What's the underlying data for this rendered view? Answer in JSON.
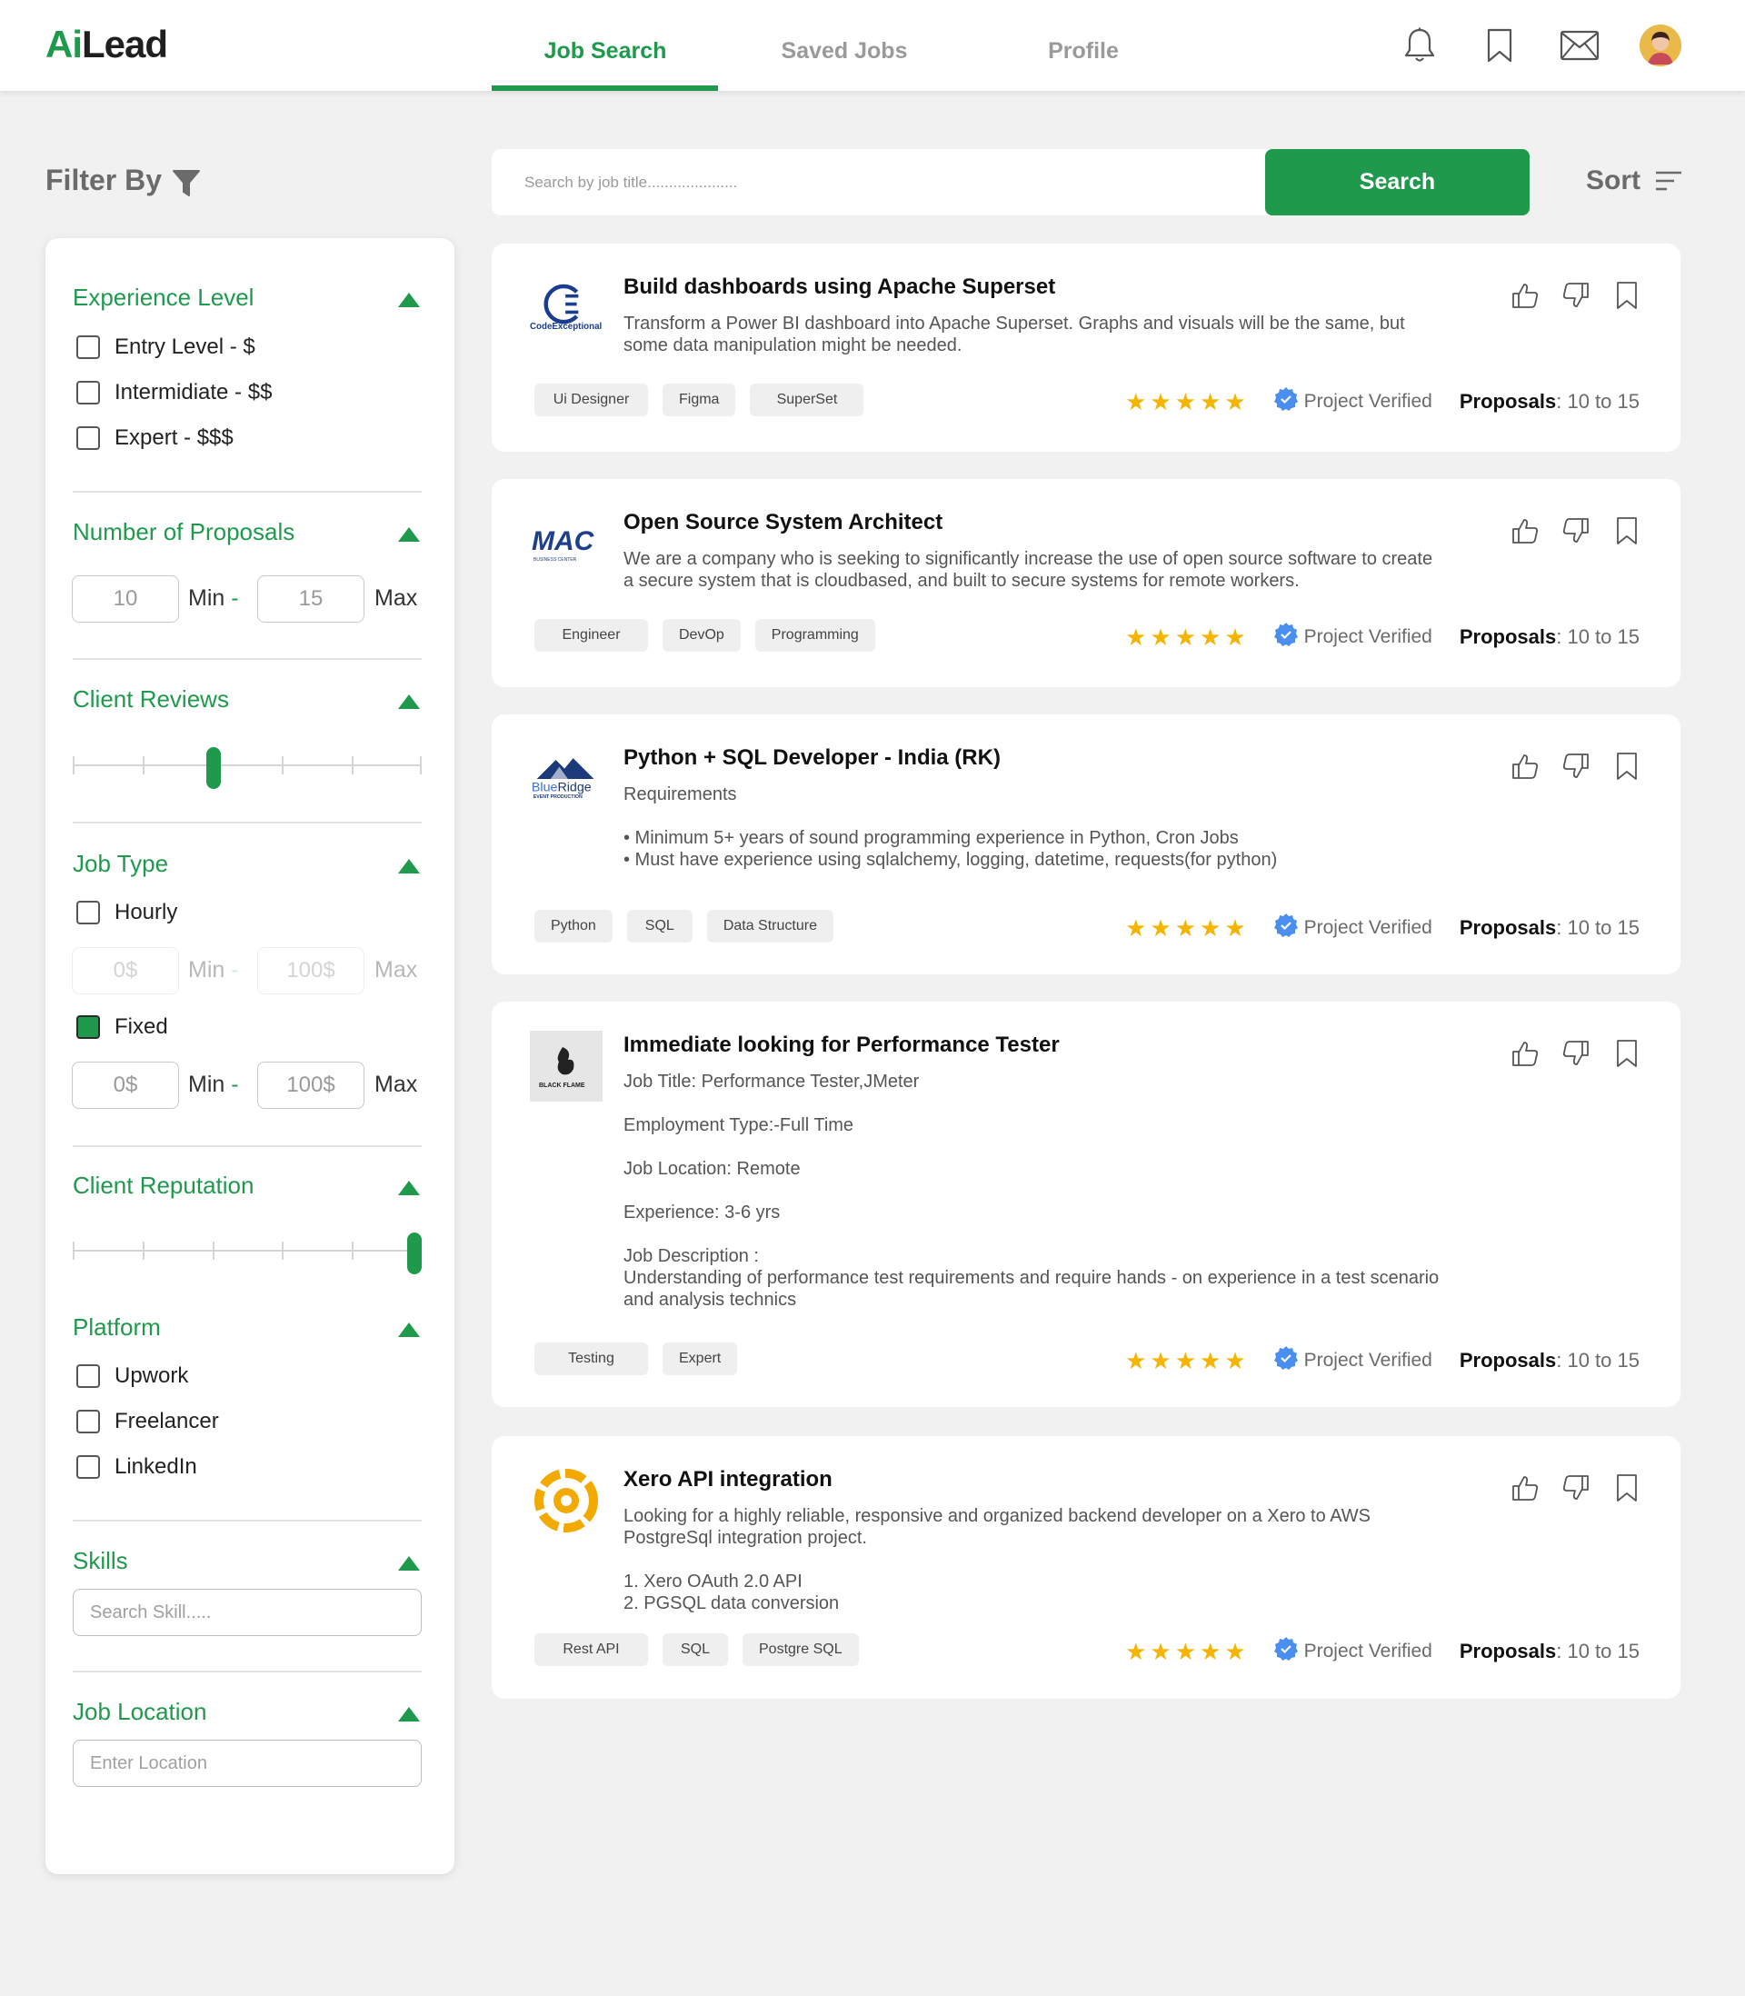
{
  "brand": {
    "logo_ai": "Ai",
    "logo_lead": "Lead"
  },
  "colors": {
    "accent": "#1f9a4d",
    "star": "#f4b400",
    "verified": "#4a8ef0"
  },
  "nav": {
    "tabs": [
      {
        "label": "Job Search",
        "active": true
      },
      {
        "label": "Saved Jobs",
        "active": false
      },
      {
        "label": "Profile",
        "active": false
      }
    ],
    "icons": [
      "bell-icon",
      "bookmark-icon",
      "mail-icon",
      "avatar"
    ]
  },
  "filter": {
    "title": "Filter By",
    "experience": {
      "title": "Experience Level",
      "options": [
        {
          "label": "Entry Level - $",
          "checked": false
        },
        {
          "label": "Intermidiate - $$",
          "checked": false
        },
        {
          "label": "Expert - $$$",
          "checked": false
        }
      ]
    },
    "proposals": {
      "title": "Number of Proposals",
      "min_value": "10",
      "min_label": "Min",
      "max_value": "15",
      "max_label": "Max",
      "dash": "-"
    },
    "client_reviews": {
      "title": "Client Reviews",
      "level": 0.4
    },
    "job_type": {
      "title": "Job Type",
      "hourly": {
        "label": "Hourly",
        "checked": false,
        "min_value": "0$",
        "max_value": "100$"
      },
      "fixed": {
        "label": "Fixed",
        "checked": true,
        "min_value": "0$",
        "max_value": "100$"
      },
      "min_label": "Min",
      "max_label": "Max",
      "dash": "-"
    },
    "client_reputation": {
      "title": "Client Reputation",
      "level": 1.0
    },
    "platform": {
      "title": "Platform",
      "options": [
        {
          "label": "Upwork",
          "checked": false
        },
        {
          "label": "Freelancer",
          "checked": false
        },
        {
          "label": "LinkedIn",
          "checked": false
        }
      ]
    },
    "skills": {
      "title": "Skills",
      "placeholder": "Search Skill....."
    },
    "location": {
      "title": "Job Location",
      "placeholder": "Enter Location"
    }
  },
  "search": {
    "placeholder": "Search by job title.....................",
    "button": "Search"
  },
  "sort": {
    "label": "Sort"
  },
  "jobs": [
    {
      "company": "CodeExceptional",
      "title": "Build dashboards using Apache Superset",
      "body": [
        "Transform a Power BI dashboard into Apache Superset. Graphs and visuals will be the same, but some data manipulation might be needed."
      ],
      "tags": [
        "Ui Designer",
        "Figma",
        "SuperSet"
      ],
      "rating": 5,
      "verified": "Project Verified",
      "proposals_label": "Proposals",
      "proposals": "10 to 15"
    },
    {
      "company": "MAC",
      "company_sub": "BUSINESS CENTER",
      "title": "Open Source System Architect",
      "body": [
        "We are a company who is seeking to significantly increase the use of open source software to create a secure system that is cloudbased, and built to secure systems for remote workers."
      ],
      "tags": [
        "Engineer",
        "DevOp",
        "Programming"
      ],
      "rating": 5,
      "verified": "Project Verified",
      "proposals_label": "Proposals",
      "proposals": "10 to 15"
    },
    {
      "company": "BlueRidge",
      "company_sub": "EVENT PRODUCTION",
      "title": "Python + SQL Developer - India (RK)",
      "body": [
        "Requirements",
        "",
        "• Minimum 5+ years of sound programming experience in Python, Cron Jobs",
        "• Must have experience using sqlalchemy, logging, datetime, requests(for python)"
      ],
      "tags": [
        "Python",
        "SQL",
        "Data Structure"
      ],
      "rating": 5,
      "verified": "Project Verified",
      "proposals_label": "Proposals",
      "proposals": "10 to 15"
    },
    {
      "company": "BLACK FLAME",
      "title": "Immediate looking for Performance Tester",
      "body": [
        "Job Title: Performance Tester,JMeter",
        "",
        "Employment Type:-Full Time",
        "",
        "Job Location: Remote",
        "",
        "Experience: 3-6 yrs",
        "",
        "Job Description :",
        "Understanding of performance test requirements and require hands - on experience in a test scenario and analysis technics"
      ],
      "tags": [
        "Testing",
        "Expert"
      ],
      "rating": 5,
      "verified": "Project Verified",
      "proposals_label": "Proposals",
      "proposals": "10 to 15"
    },
    {
      "company": "Xero",
      "title": "Xero API integration",
      "body": [
        "Looking for a highly reliable, responsive and organized backend developer on a Xero to AWS PostgreSql integration project.",
        "",
        "1. Xero OAuth 2.0 API",
        "2. PGSQL data conversion"
      ],
      "tags": [
        "Rest API",
        "SQL",
        "Postgre SQL"
      ],
      "rating": 5,
      "verified": "Project Verified",
      "proposals_label": "Proposals",
      "proposals": "10 to 15"
    }
  ]
}
